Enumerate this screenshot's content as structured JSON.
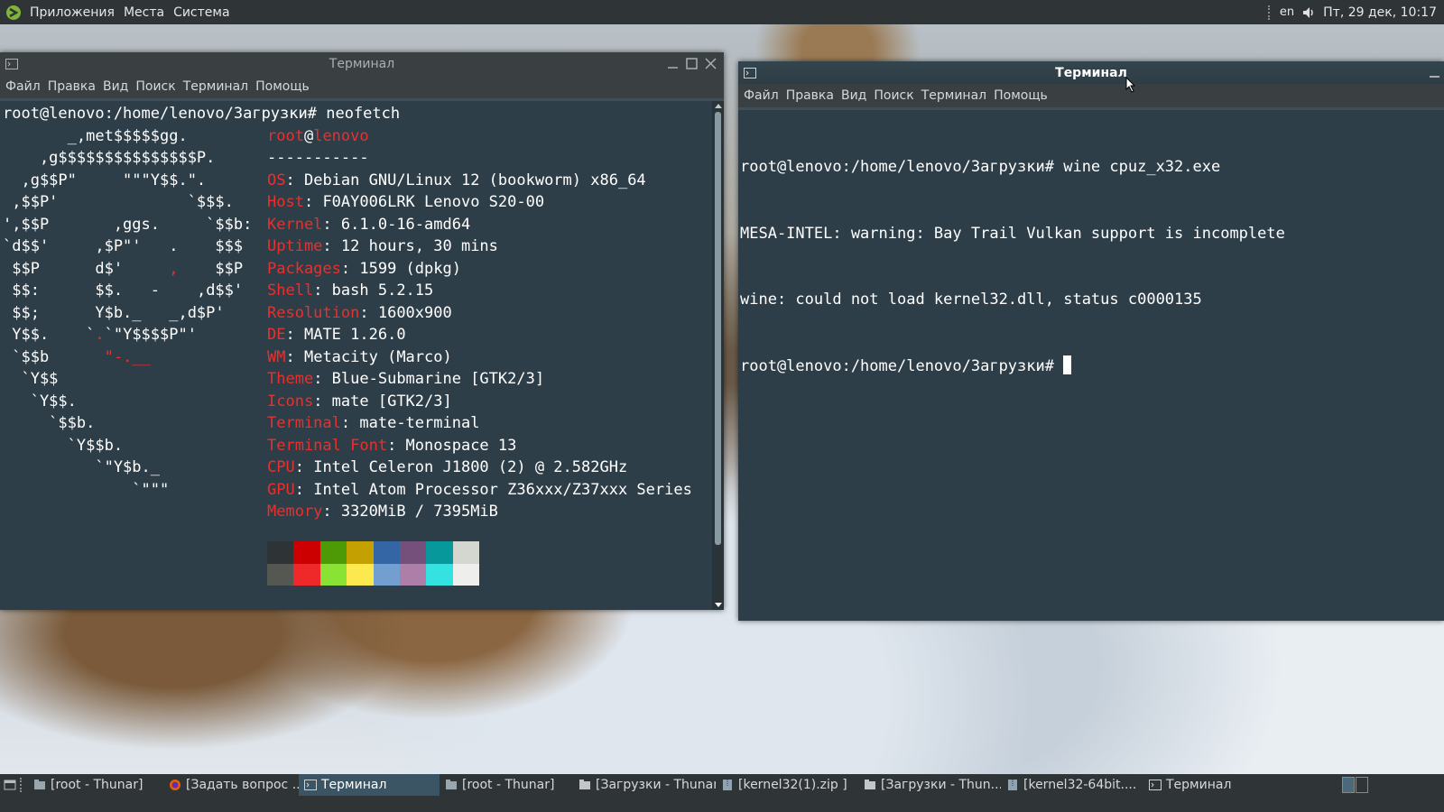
{
  "top_panel": {
    "menus": [
      "Приложения",
      "Места",
      "Система"
    ],
    "keyboard_layout": "en",
    "clock": "Пт, 29 дек, 10:17"
  },
  "left_window": {
    "title": "Терминал",
    "menu": [
      "Файл",
      "Правка",
      "Вид",
      "Поиск",
      "Терминал",
      "Помощь"
    ],
    "prompt_line": "root@lenovo:/home/lenovo/Загрузки# neofetch",
    "ascii_art": [
      "       _,met$$$$$gg.",
      "    ,g$$$$$$$$$$$$$$$P.",
      "  ,g$$P\"     \"\"\"Y$$.\".",
      " ,$$P'              `$$$.",
      "',$$P       ,ggs.     `$$b:",
      "`d$$'     ,$P\"'   .    $$$",
      " $$P      d$'     ,    $$P",
      " $$:      $$.   -    ,d$$'",
      " $$;      Y$b._   _,d$P'",
      " Y$$.    `.`\"Y$$$$P\"'",
      " `$$b      \"-.__",
      "  `Y$$",
      "   `Y$$.",
      "     `$$b.",
      "       `Y$$b.",
      "          `\"Y$b._",
      "              `\"\"\""
    ],
    "user": "root",
    "at": "@",
    "host": "lenovo",
    "separator": "-----------",
    "info": [
      {
        "key": "OS",
        "value": "Debian GNU/Linux 12 (bookworm) x86_64"
      },
      {
        "key": "Host",
        "value": "F0AY006LRK Lenovo S20-00"
      },
      {
        "key": "Kernel",
        "value": "6.1.0-16-amd64"
      },
      {
        "key": "Uptime",
        "value": "12 hours, 30 mins"
      },
      {
        "key": "Packages",
        "value": "1599 (dpkg)"
      },
      {
        "key": "Shell",
        "value": "bash 5.2.15"
      },
      {
        "key": "Resolution",
        "value": "1600x900"
      },
      {
        "key": "DE",
        "value": "MATE 1.26.0"
      },
      {
        "key": "WM",
        "value": "Metacity (Marco)"
      },
      {
        "key": "Theme",
        "value": "Blue-Submarine [GTK2/3]"
      },
      {
        "key": "Icons",
        "value": "mate [GTK2/3]"
      },
      {
        "key": "Terminal",
        "value": "mate-terminal"
      },
      {
        "key": "Terminal Font",
        "value": "Monospace 13"
      },
      {
        "key": "CPU",
        "value": "Intel Celeron J1800 (2) @ 2.582GHz"
      },
      {
        "key": "GPU",
        "value": "Intel Atom Processor Z36xxx/Z37xxx Series"
      },
      {
        "key": "Memory",
        "value": "3320MiB / 7395MiB"
      }
    ],
    "palette_colors": [
      [
        "#2e3436",
        "#cc0000",
        "#4e9a06",
        "#c4a000",
        "#3465a4",
        "#75507b",
        "#06989a",
        "#d3d7cf"
      ],
      [
        "#555753",
        "#ef2929",
        "#8ae234",
        "#fce94f",
        "#729fcf",
        "#ad7fa8",
        "#34e2e2",
        "#eeeeec"
      ]
    ]
  },
  "right_window": {
    "title": "Терминал",
    "menu": [
      "Файл",
      "Правка",
      "Вид",
      "Поиск",
      "Терминал",
      "Помощь"
    ],
    "lines": [
      "root@lenovo:/home/lenovo/Загрузки# wine cpuz_x32.exe",
      "MESA-INTEL: warning: Bay Trail Vulkan support is incomplete",
      "wine: could not load kernel32.dll, status c0000135"
    ],
    "prompt": "root@lenovo:/home/lenovo/Загрузки# "
  },
  "taskbar": {
    "tasks": [
      {
        "label": "[root - Thunar]",
        "icon": "thunar-icon",
        "active": false
      },
      {
        "label": "[Задать вопрос ...",
        "icon": "firefox-icon",
        "active": false
      },
      {
        "label": "Терминал",
        "icon": "terminal-icon",
        "active": true
      },
      {
        "label": "[root - Thunar]",
        "icon": "thunar-icon",
        "active": false
      },
      {
        "label": "[Загрузки - Thunar]",
        "icon": "folder-icon",
        "active": false
      },
      {
        "label": "[kernel32(1).zip ]",
        "icon": "archive-icon",
        "active": false
      },
      {
        "label": "[Загрузки - Thun...",
        "icon": "folder-icon",
        "active": false
      },
      {
        "label": "[kernel32-64bit....",
        "icon": "archive-icon",
        "active": false
      },
      {
        "label": "Терминал",
        "icon": "terminal-icon",
        "active": false
      }
    ]
  }
}
